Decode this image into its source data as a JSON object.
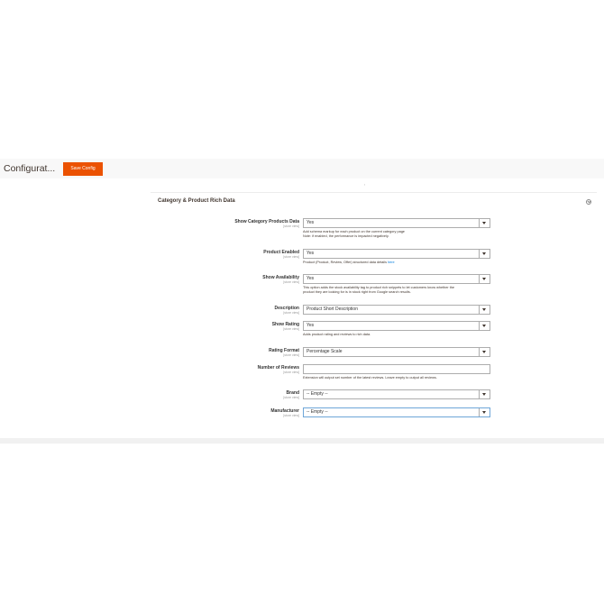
{
  "header": {
    "page_title": "Configurat...",
    "save_label": "Save Config"
  },
  "section": {
    "title": "Category & Product Rich Data",
    "collapse_icon": "circle-chevron-up-icon"
  },
  "fields": [
    {
      "label": "Show Category Products Data",
      "scope": "[store view]",
      "value": "Yes",
      "note_lines": [
        "Add schema markup for each product on the current category page",
        "Note: if enabled, the performance is impacted negatively."
      ]
    },
    {
      "label": "Product Enabled",
      "scope": "[store view]",
      "value": "Yes",
      "note_prefix": "Product (Product, Review, Offer) structured data details ",
      "note_link": "here"
    },
    {
      "label": "Show Availability",
      "scope": "[store view]",
      "value": "Yes",
      "note_lines": [
        "This option adds the stock availability tag to product rich snippets to let customers know whether the",
        "product they are looking for is in stock right from Google search results."
      ]
    },
    {
      "label": "Description",
      "scope": "[store view]",
      "value": "Product Short Description"
    },
    {
      "label": "Show Rating",
      "scope": "[store view]",
      "value": "Yes",
      "note_lines": [
        "Adds product rating and reviews to rich data."
      ]
    },
    {
      "label": "Rating Format",
      "scope": "[store view]",
      "value": "Percentage Scale"
    },
    {
      "label": "Number of Reviews",
      "scope": "[store view]",
      "value": "",
      "note_lines": [
        "Extension will output set number of the latest reviews. Leave empty to output all reviews."
      ]
    },
    {
      "label": "Brand",
      "scope": "[store view]",
      "value": "-- Empty --"
    },
    {
      "label": "Manufacturer",
      "scope": "[store view]",
      "value": "-- Empty --"
    }
  ],
  "colors": {
    "accent": "#eb5202",
    "link": "#007bdb",
    "focus_border": "#6ea6d8"
  }
}
